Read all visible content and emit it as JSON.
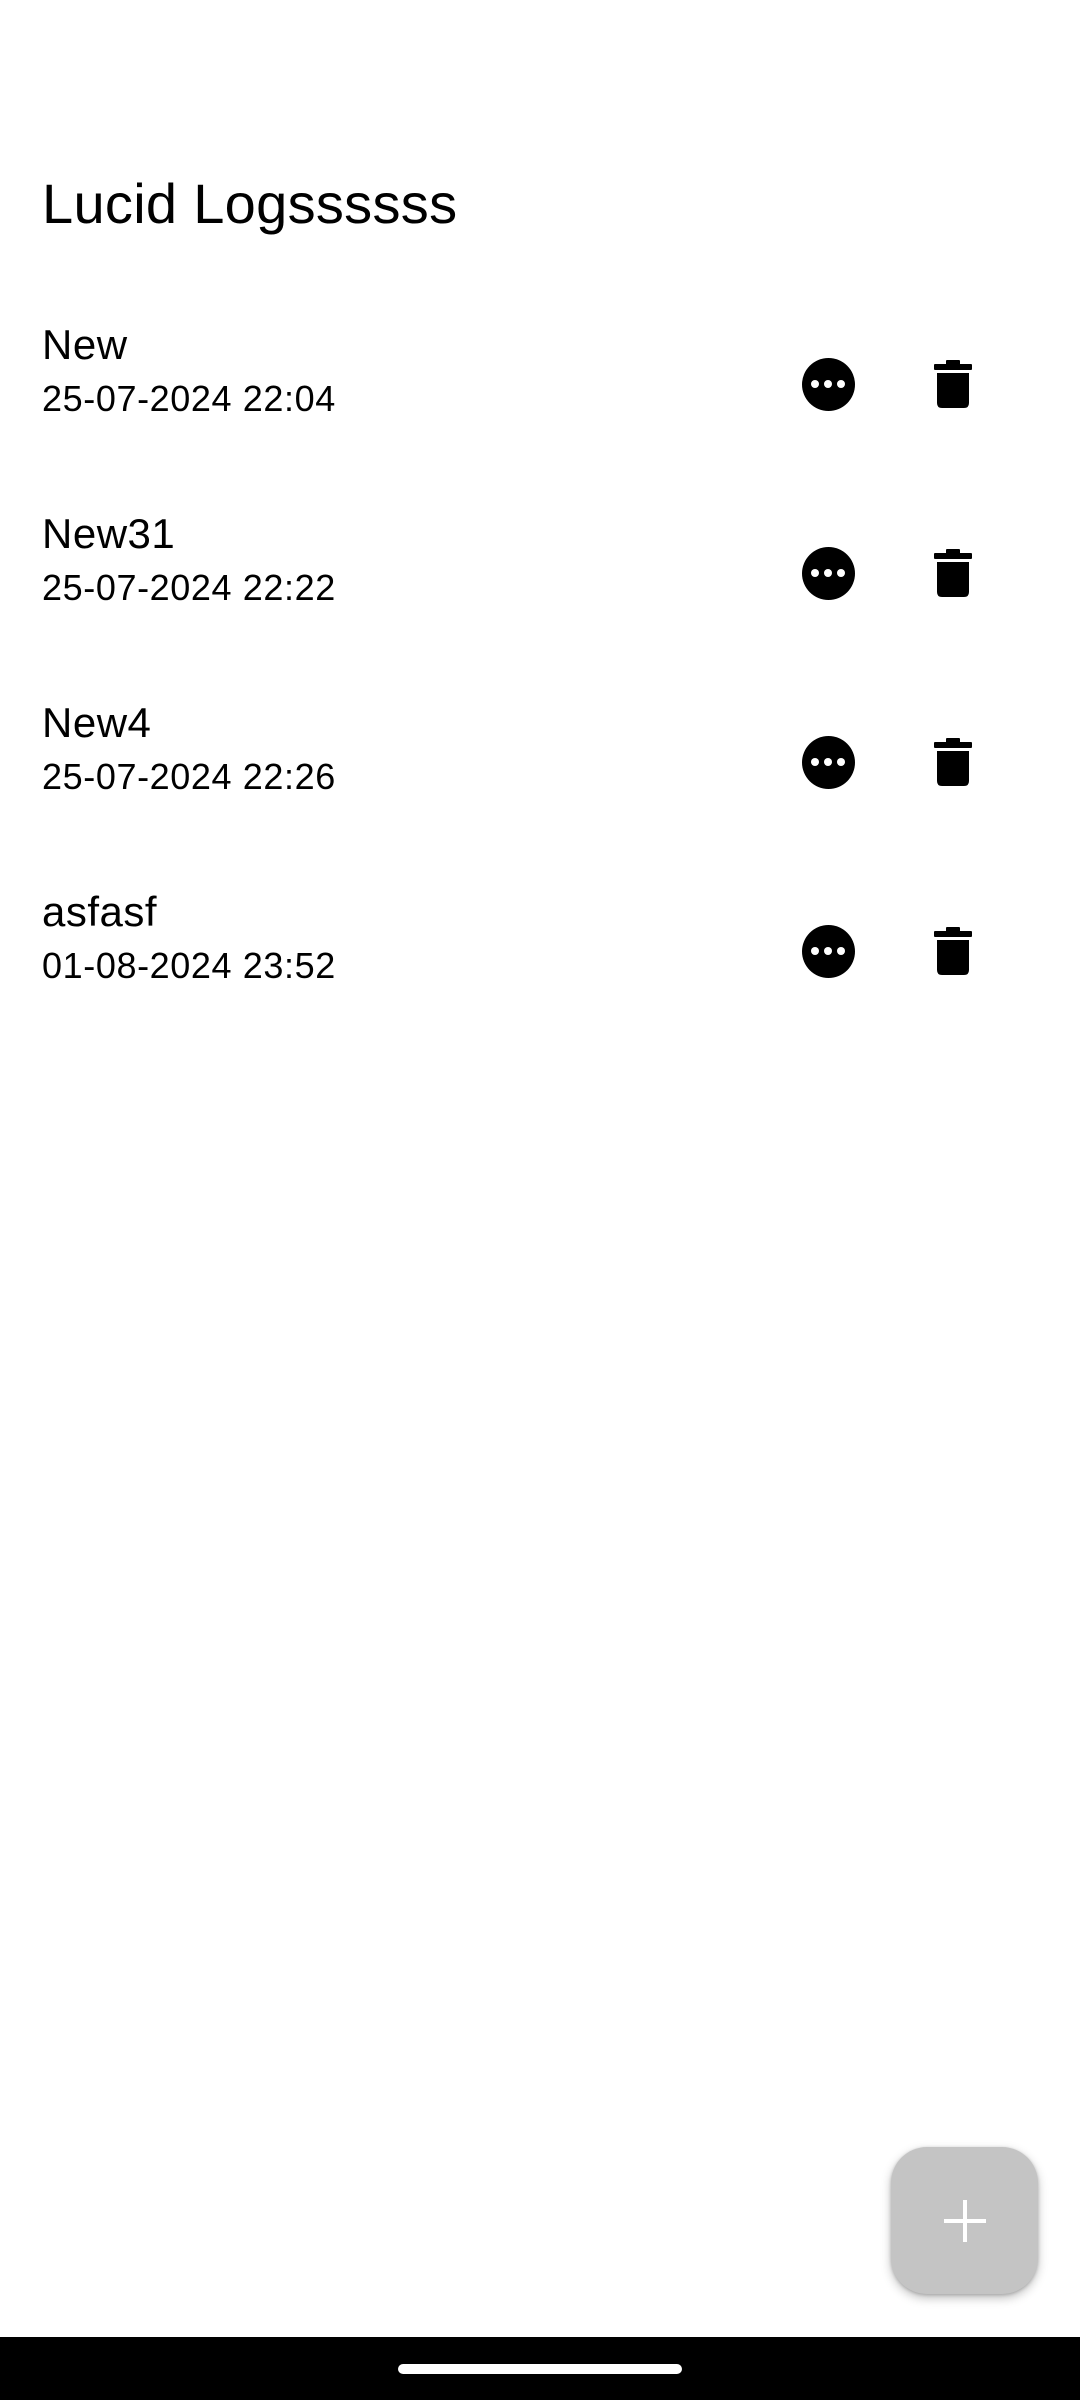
{
  "header": {
    "title": "Lucid Logssssss"
  },
  "logs": [
    {
      "name": "New",
      "date": "25-07-2024 22:04"
    },
    {
      "name": "New31",
      "date": "25-07-2024 22:22"
    },
    {
      "name": "New4",
      "date": "25-07-2024 22:26"
    },
    {
      "name": "asfasf",
      "date": "01-08-2024 23:52"
    }
  ],
  "icons": {
    "more": "more-horiz-circle-icon",
    "delete": "trash-icon",
    "add": "plus-icon"
  },
  "colors": {
    "background": "#ffffff",
    "text": "#000000",
    "fab": "#c4c4c4",
    "nav_bar": "#000000"
  }
}
